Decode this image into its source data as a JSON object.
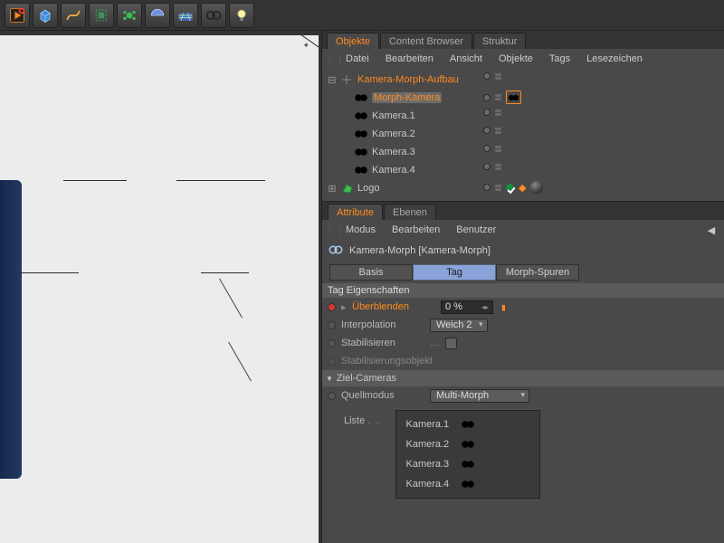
{
  "toolbar_icons": [
    "render-scene",
    "cube-primitive",
    "spline",
    "deformer",
    "mograph",
    "light",
    "floor-grid",
    "camera-morph",
    "light-bulb"
  ],
  "obj_panel": {
    "tabs": [
      {
        "label": "Objekte",
        "active": true
      },
      {
        "label": "Content Browser",
        "active": false
      },
      {
        "label": "Struktur",
        "active": false
      }
    ],
    "menu": [
      "Datei",
      "Bearbeiten",
      "Ansicht",
      "Objekte",
      "Tags",
      "Lesezeichen"
    ],
    "tree": [
      {
        "name": "Kamera-Morph-Aufbau",
        "depth": 0,
        "type": "null",
        "color": "#ff8a1e",
        "expand": "minus",
        "morphtag": false
      },
      {
        "name": "Morph-Kamera",
        "depth": 1,
        "type": "cam",
        "color": "#ff8a1e",
        "sel": true,
        "morphtag": true
      },
      {
        "name": "Kamera.1",
        "depth": 1,
        "type": "cam"
      },
      {
        "name": "Kamera.2",
        "depth": 1,
        "type": "cam"
      },
      {
        "name": "Kamera.3",
        "depth": 1,
        "type": "cam"
      },
      {
        "name": "Kamera.4",
        "depth": 1,
        "type": "cam"
      },
      {
        "name": "Logo",
        "depth": 0,
        "type": "poly",
        "expand": "plus",
        "extraTags": true
      }
    ]
  },
  "attr_panel": {
    "tabs": [
      {
        "label": "Attribute",
        "active": true
      },
      {
        "label": "Ebenen",
        "active": false
      }
    ],
    "menu": [
      "Modus",
      "Bearbeiten",
      "Benutzer"
    ],
    "title": "Kamera-Morph [Kamera-Morph]",
    "modes": [
      {
        "label": "Basis",
        "active": false
      },
      {
        "label": "Tag",
        "active": true
      },
      {
        "label": "Morph-Spuren",
        "active": false
      }
    ],
    "section": "Tag Eigenschaften",
    "props": {
      "blend_label": "Überblenden",
      "blend_value": "0 %",
      "interp_label": "Interpolation",
      "interp_value": "Weich 2",
      "stab_label": "Stabilisieren",
      "stabobj_label": "Stabilisierungsobjekt",
      "zielcams": "Ziel-Cameras",
      "quell_label": "Quellmodus",
      "quell_value": "Multi-Morph",
      "list_label": "Liste",
      "list": [
        "Kamera.1",
        "Kamera.2",
        "Kamera.3",
        "Kamera.4"
      ]
    }
  }
}
